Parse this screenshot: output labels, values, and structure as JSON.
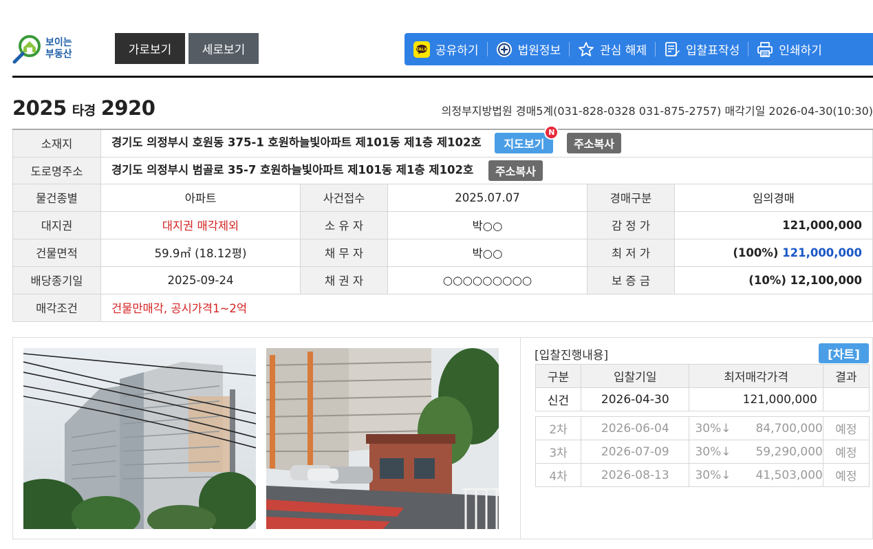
{
  "logo": {
    "line1": "보이는",
    "line2": "부동산"
  },
  "view_toggle": {
    "horizontal": "가로보기",
    "vertical": "세로보기"
  },
  "toolbar": {
    "share": "공유하기",
    "court_info": "법원정보",
    "unfavorite": "관심 해제",
    "bid_form": "입찰표작성",
    "print": "인쇄하기"
  },
  "case": {
    "year": "2025",
    "type": "타경",
    "number": "2920",
    "court_line": "의정부지방법원 경매5계(031-828-0328 031-875-2757) 매각기일 2026-04-30(10:30)"
  },
  "info": {
    "location_label": "소재지",
    "location": "경기도 의정부시 호원동 375-1 호원하늘빛아파트 제101동 제1층 제102호",
    "map_button": "지도보기",
    "new_badge": "N",
    "copy_button": "주소복사",
    "road_label": "도로명주소",
    "road": "경기도 의정부시 범골로 35-7 호원하늘빛아파트 제101동 제1층 제102호",
    "rows": [
      {
        "l1": "물건종별",
        "v1": "아파트",
        "l2": "사건접수",
        "v2": "2025.07.07",
        "l3": "경매구분",
        "v3": "임의경매"
      },
      {
        "l1": "대지권",
        "v1": "대지권 매각제외",
        "l2": "소 유 자",
        "v2": "박○○",
        "l3": "감 정 가",
        "v3": "121,000,000"
      },
      {
        "l1": "건물면적",
        "v1": "59.9㎡ (18.12평)",
        "l2": "채 무 자",
        "v2": "박○○",
        "l3": "최 저 가",
        "v3a": "(100%)",
        "v3b": "121,000,000"
      },
      {
        "l1": "배당종기일",
        "v1": "2025-09-24",
        "l2": "채 권 자",
        "v2": "○○○○○○○○○",
        "l3": "보 증 금",
        "v3": "(10%) 12,100,000"
      }
    ],
    "condition_label": "매각조건",
    "condition": "건물만매각, 공시가격1~2억"
  },
  "bid": {
    "title": "[입찰진행내용]",
    "chart_button": "[차트]",
    "headers": [
      "구분",
      "입찰기일",
      "최저매각가격",
      "결과"
    ],
    "current": {
      "round": "신건",
      "date": "2026-04-30",
      "price": "121,000,000",
      "result": ""
    },
    "future": [
      {
        "round": "2차",
        "date": "2026-06-04",
        "pct": "30%↓",
        "price": "84,700,000",
        "result": "예정"
      },
      {
        "round": "3차",
        "date": "2026-07-09",
        "pct": "30%↓",
        "price": "59,290,000",
        "result": "예정"
      },
      {
        "round": "4차",
        "date": "2026-08-13",
        "pct": "30%↓",
        "price": "41,503,000",
        "result": "예정"
      }
    ]
  },
  "colors": {
    "toolbar_blue": "#2f80e5",
    "accent_red": "#d52222",
    "accent_blue": "#1a58c7",
    "tag_blue": "#4a9ee6"
  }
}
